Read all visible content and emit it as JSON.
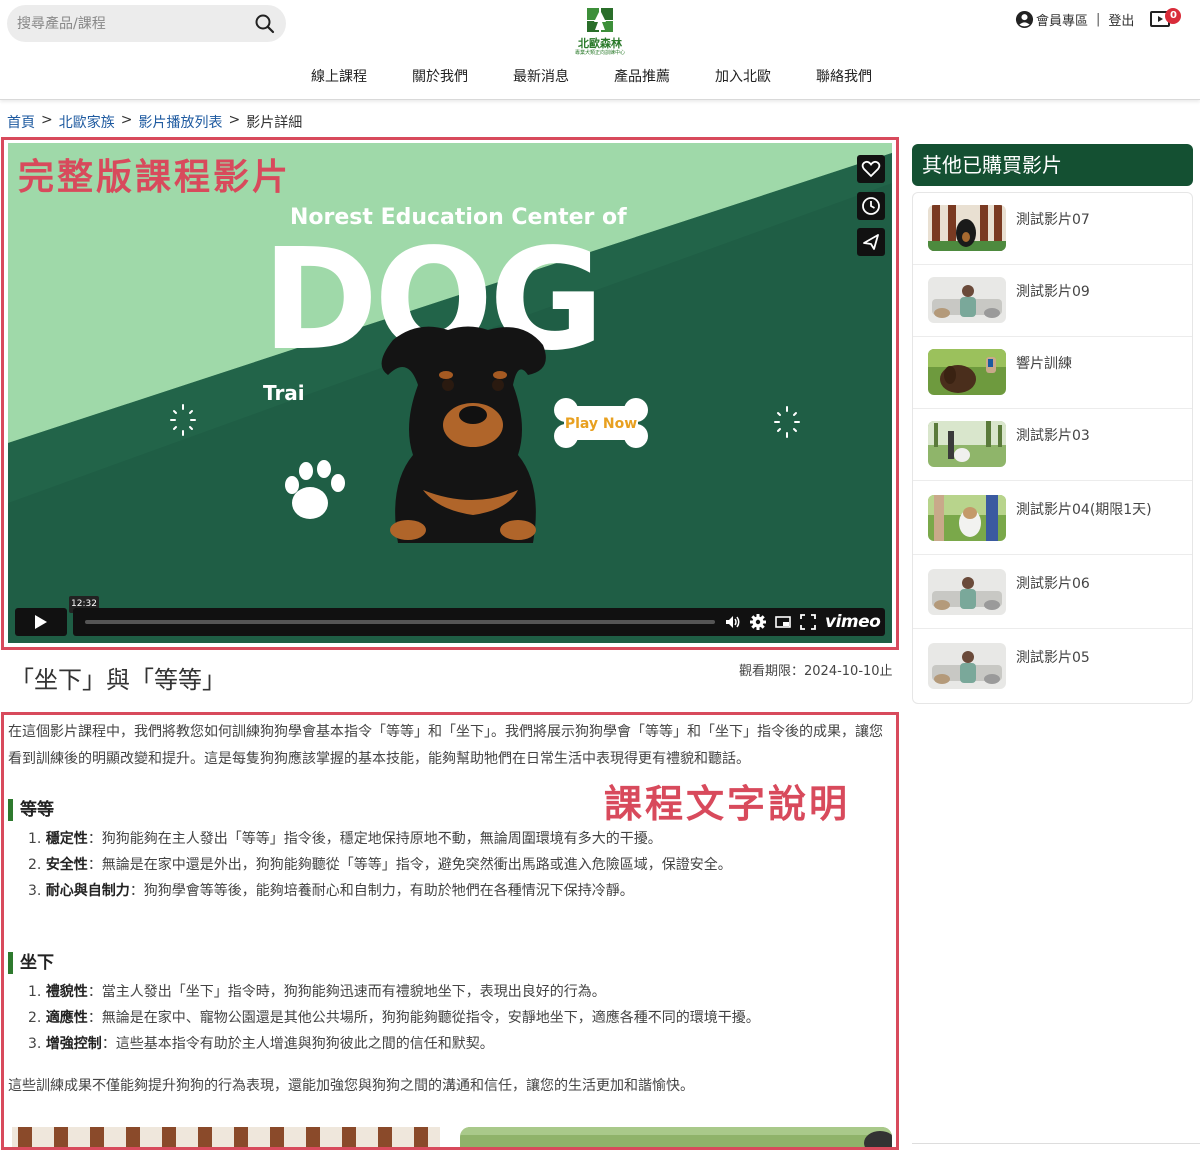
{
  "header": {
    "search_placeholder": "搜尋產品/課程",
    "logo_name": "北歐森林",
    "logo_sub": "專業犬類正向訓練中心",
    "member_label": "會員專區",
    "separator": "|",
    "logout_label": "登出",
    "cart_count": "0",
    "nav": [
      "線上課程",
      "關於我們",
      "最新消息",
      "產品推薦",
      "加入北歐",
      "聯絡我們"
    ]
  },
  "breadcrumb": {
    "items": [
      "首頁",
      "北歐家族",
      "影片播放列表",
      "影片詳細"
    ],
    "separator": ">"
  },
  "annotations": {
    "video": "完整版課程影片",
    "description": "課程文字說明"
  },
  "video": {
    "heading": "Norest Education Center of",
    "big_word": "DOG",
    "partial_word": "Trai",
    "play_now": "Play Now",
    "timestamp": "12:32",
    "brand": "vimeo",
    "side_icons": [
      "heart-icon",
      "clock-icon",
      "send-icon"
    ],
    "bg_color": "#1f5e45",
    "accent_color": "#9fd9a9"
  },
  "main": {
    "title": "「坐下」與「等等」",
    "expiry": "觀看期限：2024-10-10止",
    "intro": "在這個影片課程中，我們將教您如何訓練狗狗學會基本指令「等等」和「坐下」。我們將展示狗狗學會「等等」和「坐下」指令後的成果，讓您看到訓練後的明顯改變和提升。這是每隻狗狗應該掌握的基本技能，能夠幫助牠們在日常生活中表現得更有禮貌和聽話。",
    "sections": [
      {
        "heading": "等等",
        "items": [
          {
            "num": "1.",
            "term": "穩定性",
            "text": "：狗狗能夠在主人發出「等等」指令後，穩定地保持原地不動，無論周圍環境有多大的干擾。"
          },
          {
            "num": "2.",
            "term": "安全性",
            "text": "：無論是在家中還是外出，狗狗能夠聽從「等等」指令，避免突然衝出馬路或進入危險區域，保證安全。"
          },
          {
            "num": "3.",
            "term": "耐心與自制力",
            "text": "：狗狗學會等等後，能夠培養耐心和自制力，有助於牠們在各種情況下保持冷靜。"
          }
        ]
      },
      {
        "heading": "坐下",
        "items": [
          {
            "num": "1.",
            "term": "禮貌性",
            "text": "：當主人發出「坐下」指令時，狗狗能夠迅速而有禮貌地坐下，表現出良好的行為。"
          },
          {
            "num": "2.",
            "term": "適應性",
            "text": "：無論是在家中、寵物公園還是其他公共場所，狗狗能夠聽從指令，安靜地坐下，適應各種不同的環境干擾。"
          },
          {
            "num": "3.",
            "term": "增強控制",
            "text": "：這些基本指令有助於主人增進與狗狗彼此之間的信任和默契。"
          }
        ]
      }
    ],
    "outro": "這些訓練成果不僅能夠提升狗狗的行為表現，還能加強您與狗狗之間的溝通和信任，讓您的生活更加和諧愉快。"
  },
  "sidebar": {
    "title": "其他已購買影片",
    "items": [
      {
        "label": "測試影片07"
      },
      {
        "label": "測試影片09"
      },
      {
        "label": "響片訓練"
      },
      {
        "label": "測試影片03"
      },
      {
        "label": "測試影片04(期限1天)"
      },
      {
        "label": "測試影片06"
      },
      {
        "label": "測試影片05"
      }
    ]
  }
}
